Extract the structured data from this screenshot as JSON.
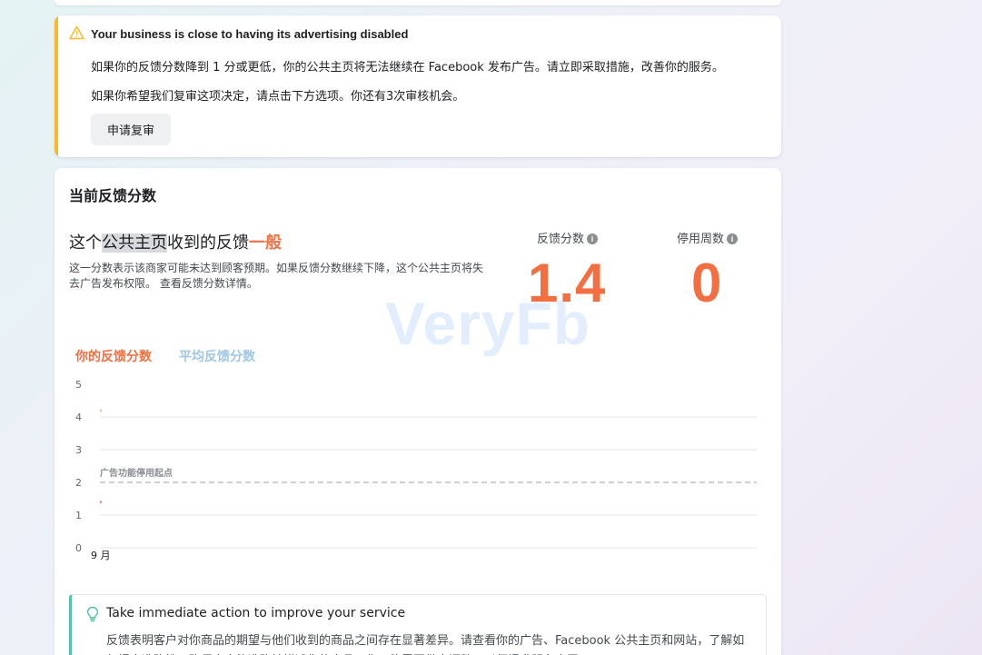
{
  "warning": {
    "title": "Your business is close to having its advertising disabled",
    "line1": "如果你的反馈分数降到 1 分或更低，你的公共主页将无法继续在 Facebook 发布广告。请立即采取措施，改善你的服务。",
    "line2": "如果你希望我们复审这项决定，请点击下方选项。你还有3次审核机会。",
    "review_button": "申请复审",
    "accent_color": "#f7b928",
    "icon": "warning-triangle-icon"
  },
  "feedback": {
    "title": "当前反馈分数",
    "headline_pre": "这个",
    "headline_highlight": "公共主页",
    "headline_mid": "收到的反馈",
    "headline_level": "一般",
    "description": "这一分数表示该商家可能未达到顾客预期。如果反馈分数继续下降，这个公共主页将失去广告发布权限。",
    "details_link": "查看反馈分数详情。",
    "score_label": "反馈分数",
    "score_value": "1.4",
    "weeks_label": "停用周数",
    "weeks_value": "0",
    "accent_color": "#f36f42",
    "watermark": "VeryFb"
  },
  "chart_data": {
    "type": "scatter",
    "legend": [
      "你的反馈分数",
      "平均反馈分数"
    ],
    "y_ticks": [
      "5",
      "4",
      "3",
      "2",
      "1",
      "0"
    ],
    "ylim": [
      0,
      5
    ],
    "x_ticks": [
      "9 月"
    ],
    "threshold": {
      "value": 2,
      "label": "广告功能停用起点"
    },
    "series": [
      {
        "name": "你的反馈分数",
        "color": "#f36f42",
        "points": [
          {
            "x": "9 月",
            "y": 1.4
          }
        ]
      },
      {
        "name": "平均反馈分数",
        "color": "#9fc7e6",
        "points": [
          {
            "x": "9 月",
            "y": 4.2
          }
        ]
      }
    ],
    "grid": true
  },
  "tip": {
    "title": "Take immediate action to improve your service",
    "text": "反馈表明客户对你商品的期望与他们收到的商品之间存在显著差异。请查看你的广告、Facebook 公共主页和网站，了解如何提高准确性，确保充实能准确地描述你的商品。你可能需要做出调整，以便提升服务水平。",
    "accent_color": "#52c0a5",
    "icon": "lightbulb-icon"
  }
}
